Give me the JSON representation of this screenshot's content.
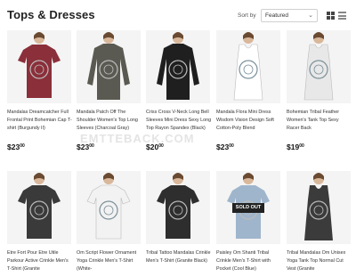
{
  "header": {
    "title": "Tops & Dresses",
    "sort_label": "Sort by",
    "sort_value": "Featured"
  },
  "watermark": "EMTTEBACK.COM",
  "products": [
    {
      "name": "Mandalas Dreamcatcher Full Frontal Print Bohemian Cap T-shirt (Burgundy II)",
      "price": "$23",
      "cents": "00",
      "color": "#8b2f3a",
      "sleeve": "short"
    },
    {
      "name": "Mandala Patch Off The Shoulder Women's Top Long Sleeves (Charcoal Gray)",
      "price": "$23",
      "cents": "00",
      "color": "#5b5a52",
      "sleeve": "long"
    },
    {
      "name": "Criss Cross V-Neck Long Bell Sleeves Mini Dress Sexy Long Top Rayon Spandex (Black)",
      "price": "$20",
      "cents": "00",
      "color": "#1f1f1f",
      "sleeve": "long"
    },
    {
      "name": "Mandala Flora Mini Dress Wisdom Vision Design Soft Cotton-Poly Blend",
      "price": "$23",
      "cents": "00",
      "color": "#ffffff",
      "sleeve": "none"
    },
    {
      "name": "Bohemian Tribal Feather Women's Tank Top Sexy Racer Back",
      "price": "$19",
      "cents": "00",
      "color": "#e8e8e8",
      "sleeve": "none"
    },
    {
      "name": "Etre Fort Pour Etre Utile Parkour Active Crinkle Men's T-Shirt (Granite",
      "price": "",
      "cents": "",
      "color": "#3a3a3a",
      "sleeve": "short"
    },
    {
      "name": "Om Script Flower Ornament Yoga Crinkle Men's T-Shirt (White-",
      "price": "",
      "cents": "",
      "color": "#f2f2f2",
      "sleeve": "short"
    },
    {
      "name": "Tribal Tattoo Mandalas Crinkle Men's T-Shirt (Granite Black)",
      "price": "",
      "cents": "",
      "color": "#2e2e2e",
      "sleeve": "short"
    },
    {
      "name": "Paisley Om Shanti Tribal Crinkle Men's T-Shirt with Pocket (Cool Blue)",
      "price": "",
      "cents": "",
      "color": "#9fb5cc",
      "sleeve": "short",
      "badge": "SOLD OUT"
    },
    {
      "name": "Tribal Mandalas Om Unisex Yoga Tank Top Normal Cut Vest (Granite",
      "price": "",
      "cents": "",
      "color": "#3b3b3b",
      "sleeve": "none"
    }
  ]
}
